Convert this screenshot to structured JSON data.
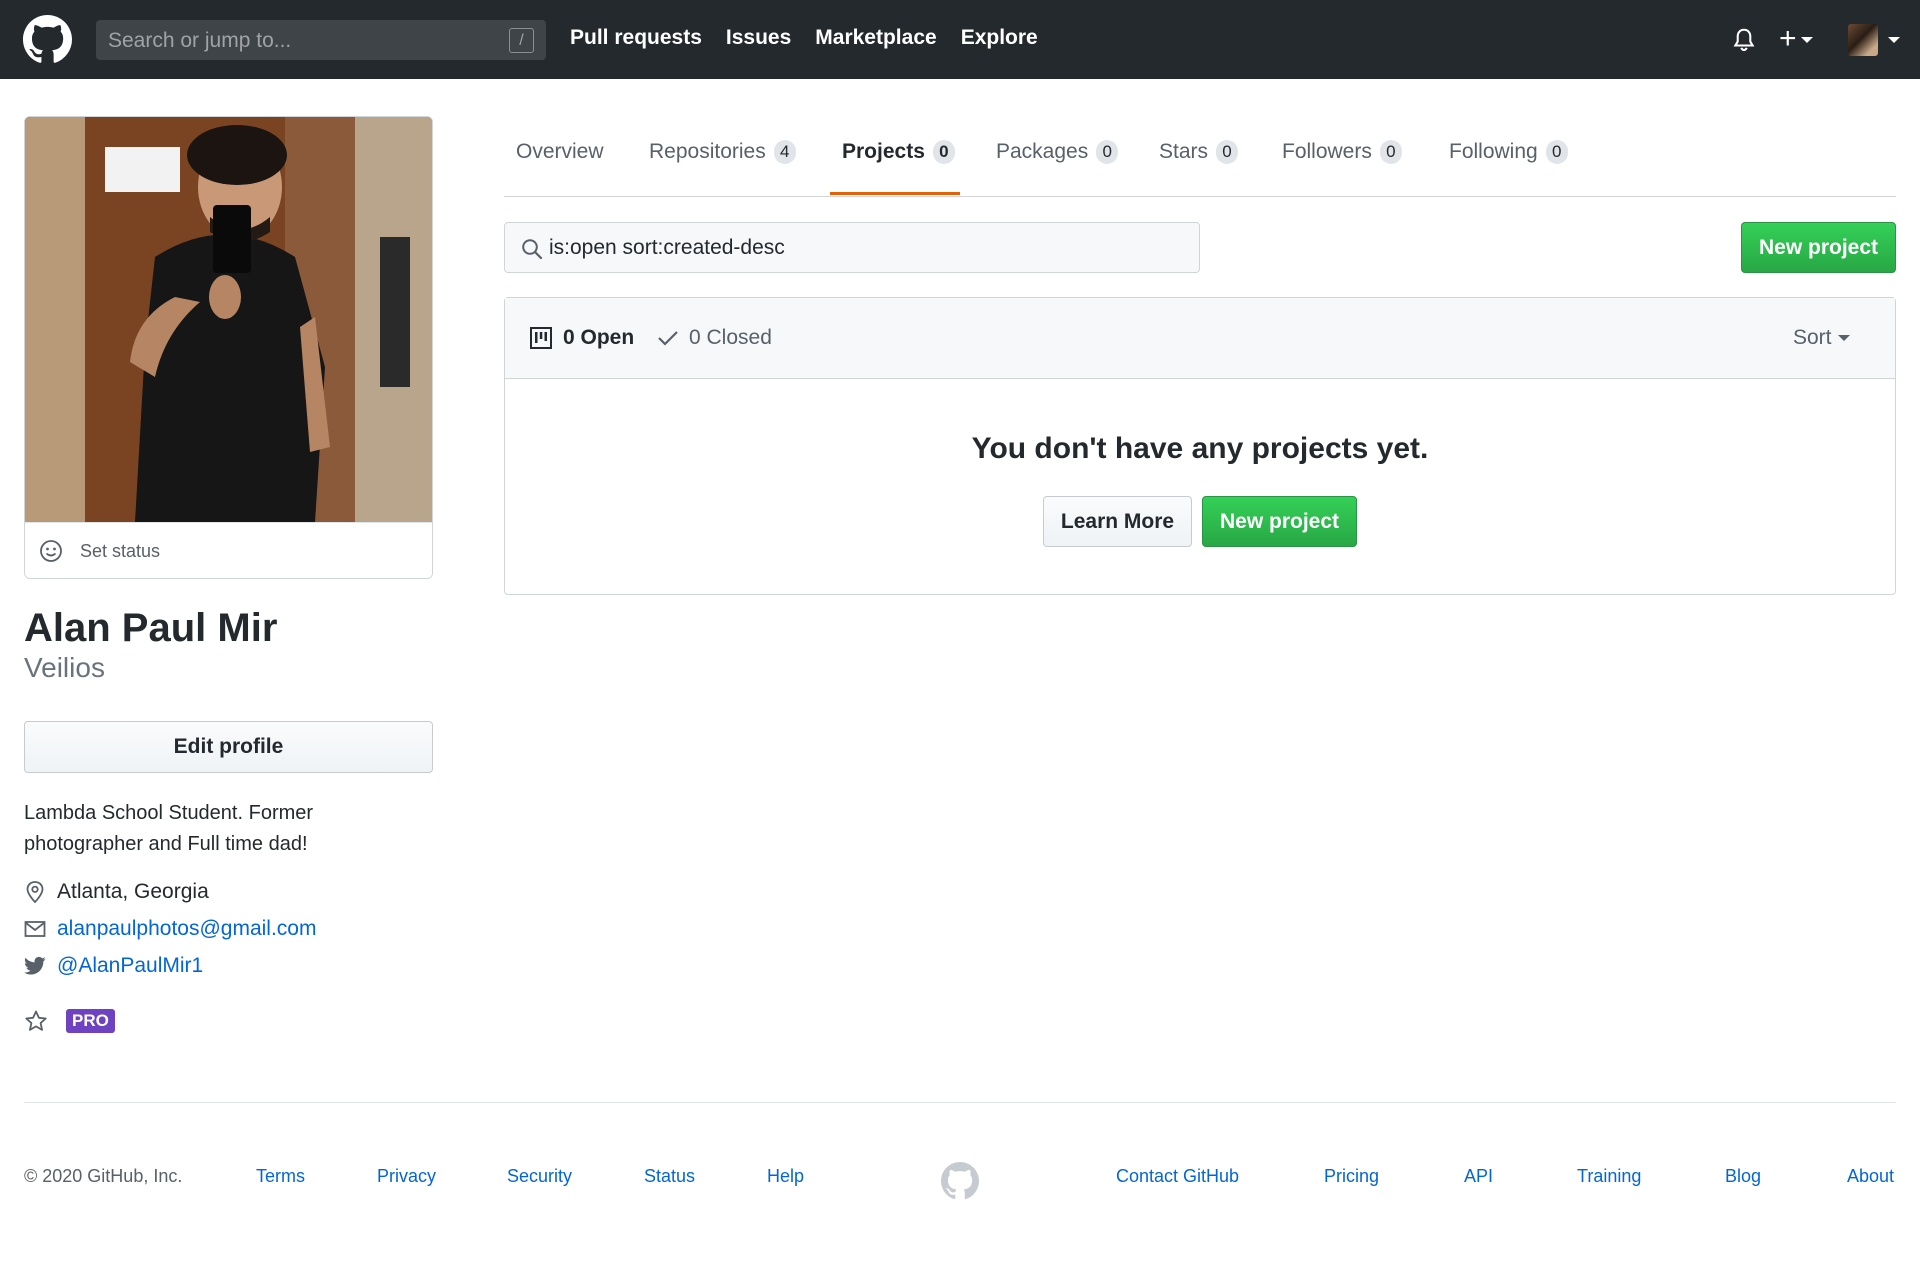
{
  "header": {
    "search_placeholder": "Search or jump to...",
    "search_key": "/",
    "nav": [
      "Pull requests",
      "Issues",
      "Marketplace",
      "Explore"
    ],
    "plus_label": "+"
  },
  "profile": {
    "status_label": "Set status",
    "name": "Alan Paul Mir",
    "username": "Veilios",
    "edit_label": "Edit profile",
    "bio": "Lambda School Student. Former photographer and Full time dad!",
    "location": "Atlanta, Georgia",
    "email": "alanpaulphotos@gmail.com",
    "twitter": "@AlanPaulMir1",
    "pro_badge": "PRO"
  },
  "tabs": [
    {
      "label": "Overview",
      "count": null
    },
    {
      "label": "Repositories",
      "count": "4"
    },
    {
      "label": "Projects",
      "count": "0"
    },
    {
      "label": "Packages",
      "count": "0"
    },
    {
      "label": "Stars",
      "count": "0"
    },
    {
      "label": "Followers",
      "count": "0"
    },
    {
      "label": "Following",
      "count": "0"
    }
  ],
  "projects": {
    "filter_value": "is:open sort:created-desc",
    "new_project_label": "New project",
    "open_label": "0 Open",
    "closed_label": "0 Closed",
    "sort_label": "Sort",
    "blank_title": "You don't have any projects yet.",
    "learn_more_label": "Learn More"
  },
  "footer": {
    "copyright": "© 2020 GitHub, Inc.",
    "left_links": [
      "Terms",
      "Privacy",
      "Security",
      "Status",
      "Help"
    ],
    "right_links": [
      "Contact GitHub",
      "Pricing",
      "API",
      "Training",
      "Blog",
      "About"
    ]
  },
  "colors": {
    "header_bg": "#24292e",
    "green_button": "#28a745",
    "tab_accent": "#e36209",
    "link": "#0366d6",
    "pro_badge": "#6f42c1"
  }
}
